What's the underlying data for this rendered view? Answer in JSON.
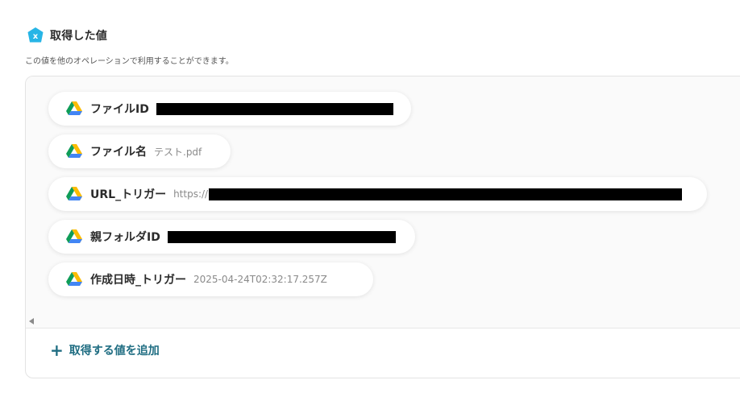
{
  "section": {
    "title": "取得した値",
    "description": "この値を他のオペレーションで利用することができます。",
    "icon": "variable-icon",
    "accent_color": "#27b5e6"
  },
  "values": [
    {
      "label": "ファイルID",
      "value": "",
      "redacted": true,
      "icon": "google-drive-icon"
    },
    {
      "label": "ファイル名",
      "value": "テスト.pdf",
      "redacted": false,
      "icon": "google-drive-icon"
    },
    {
      "label": "URL_トリガー",
      "value": "https://",
      "redacted": true,
      "icon": "google-drive-icon"
    },
    {
      "label": "親フォルダID",
      "value": "",
      "redacted": true,
      "icon": "google-drive-icon"
    },
    {
      "label": "作成日時_トリガー",
      "value": "2025-04-24T02:32:17.257Z",
      "redacted": false,
      "icon": "google-drive-icon"
    }
  ],
  "add_button": {
    "label": "取得する値を追加",
    "icon": "plus-icon",
    "color": "#1f6d82"
  }
}
